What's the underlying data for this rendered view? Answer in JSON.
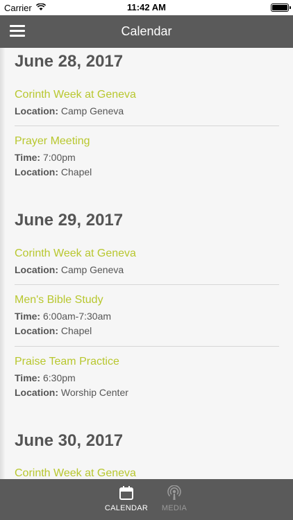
{
  "status_bar": {
    "carrier": "Carrier",
    "time": "11:42 AM"
  },
  "nav": {
    "title": "Calendar"
  },
  "days": [
    {
      "date": "June 28, 2017",
      "events": [
        {
          "title": "Corinth Week at Geneva",
          "location_label": "Location:",
          "location": "Camp Geneva"
        },
        {
          "title": "Prayer Meeting",
          "time_label": "Time:",
          "time": "7:00pm",
          "location_label": "Location:",
          "location": "Chapel"
        }
      ]
    },
    {
      "date": "June 29, 2017",
      "events": [
        {
          "title": "Corinth Week at Geneva",
          "location_label": "Location:",
          "location": "Camp Geneva"
        },
        {
          "title": "Men's Bible Study",
          "time_label": "Time:",
          "time": "6:00am-7:30am",
          "location_label": "Location:",
          "location": "Chapel"
        },
        {
          "title": "Praise Team Practice",
          "time_label": "Time:",
          "time": "6:30pm",
          "location_label": "Location:",
          "location": "Worship Center"
        }
      ]
    },
    {
      "date": "June 30, 2017",
      "events": [
        {
          "title": "Corinth Week at Geneva"
        }
      ]
    }
  ],
  "tabs": [
    {
      "label": "CALENDAR",
      "icon": "calendar-icon",
      "active": true
    },
    {
      "label": "MEDIA",
      "icon": "podcast-icon",
      "active": false
    }
  ],
  "colors": {
    "accent": "#b8c72e",
    "bar": "#5a5a5a",
    "text": "#555555"
  }
}
